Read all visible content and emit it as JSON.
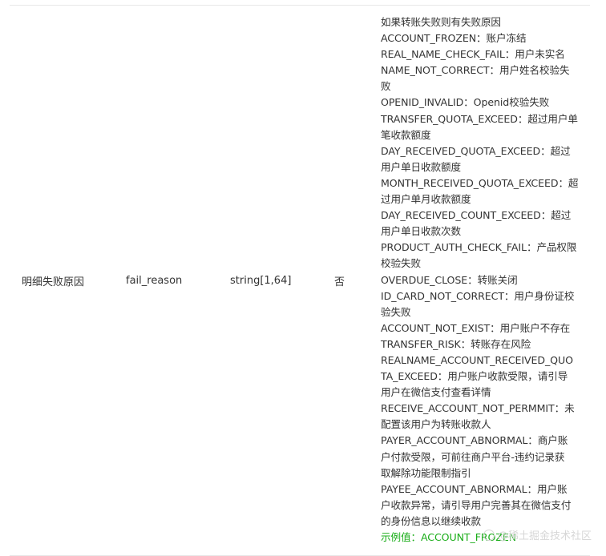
{
  "row": {
    "name": "明细失败原因",
    "param": "fail_reason",
    "type": "string[1,64]",
    "required": "否",
    "description_lines": [
      "如果转账失败则有失败原因",
      "ACCOUNT_FROZEN：账户冻结",
      "REAL_NAME_CHECK_FAIL：用户未实名",
      "NAME_NOT_CORRECT：用户姓名校验失",
      "败",
      "OPENID_INVALID：Openid校验失败",
      "TRANSFER_QUOTA_EXCEED：超过用户单",
      "笔收款额度",
      "DAY_RECEIVED_QUOTA_EXCEED：超过",
      "用户单日收款额度",
      "MONTH_RECEIVED_QUOTA_EXCEED：超",
      "过用户单月收款额度",
      "DAY_RECEIVED_COUNT_EXCEED：超过",
      "用户单日收款次数",
      "PRODUCT_AUTH_CHECK_FAIL：产品权限",
      "校验失败",
      "OVERDUE_CLOSE：转账关闭",
      "ID_CARD_NOT_CORRECT：用户身份证校",
      "验失败",
      "ACCOUNT_NOT_EXIST：用户账户不存在",
      "TRANSFER_RISK：转账存在风险",
      "REALNAME_ACCOUNT_RECEIVED_QUO",
      "TA_EXCEED：用户账户收款受限，请引导",
      "用户在微信支付查看详情",
      "RECEIVE_ACCOUNT_NOT_PERMMIT：未",
      "配置该用户为转账收款人",
      "PAYER_ACCOUNT_ABNORMAL：商户账",
      "户付款受限，可前往商户平台-违约记录获",
      "取解除功能限制指引",
      "PAYEE_ACCOUNT_ABNORMAL：用户账",
      "户收款异常，请引导用户完善其在微信支付",
      "的身份信息以继续收款"
    ],
    "example": "示例值：ACCOUNT_FROZEN"
  },
  "watermark": {
    "text": "@稀土掘金技术社区"
  }
}
